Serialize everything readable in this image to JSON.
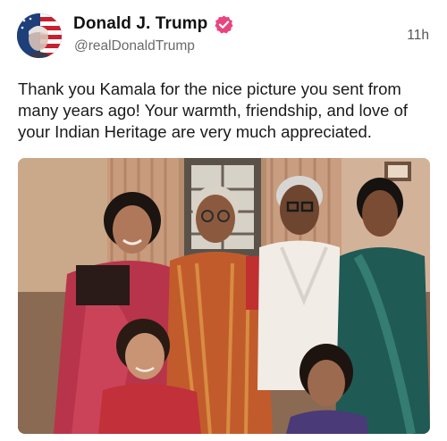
{
  "post": {
    "author": {
      "display_name": "Donald J. Trump",
      "handle": "@realDonaldTrump",
      "verified": true,
      "verified_icon": "verified-badge-icon",
      "verified_color": "#e8457f"
    },
    "timestamp": "11h",
    "text": "Thank you Kamala for the nice picture you sent from many years ago! Your warmth, friendship, and love of your Indian Heritage are very much appreciated.",
    "media": {
      "type": "photo",
      "description_icon": "family-photo"
    }
  },
  "colors": {
    "text": "#1a1a1a",
    "secondary": "#6a6a6a",
    "badge": "#e8457f"
  }
}
